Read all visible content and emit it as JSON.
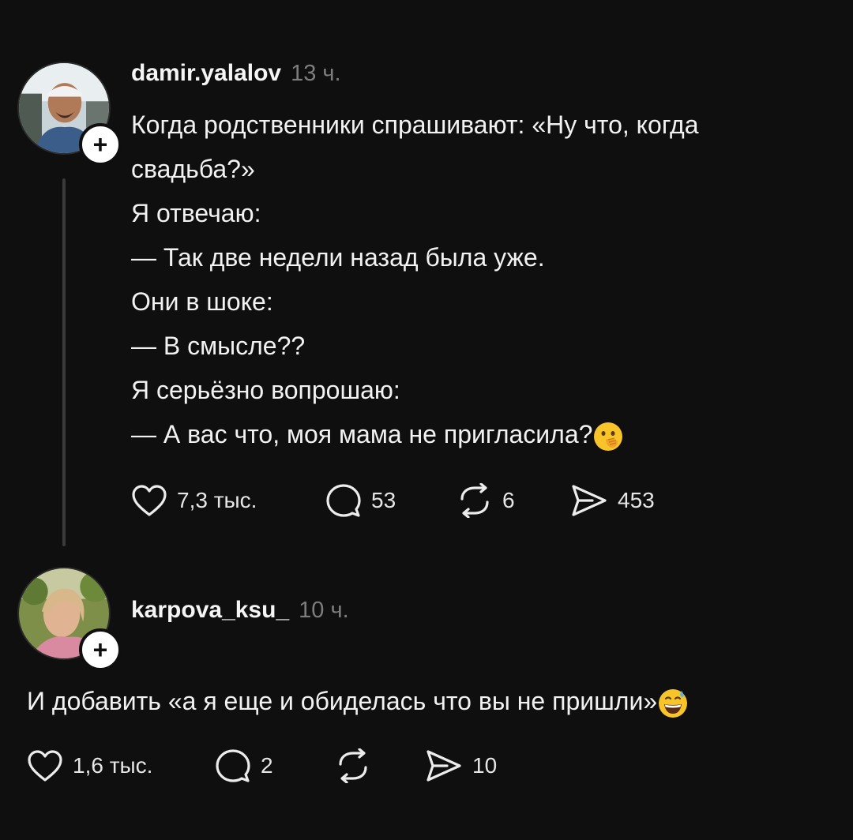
{
  "posts": [
    {
      "username": "damir.yalalov",
      "time": "13 ч.",
      "lines": [
        "Когда родственники спрашивают: «Ну что, когда",
        "свадьба?»",
        "Я отвечаю:",
        "— Так две недели назад была уже.",
        "Они в шоке:",
        "— В смысле??",
        "Я серьёзно вопрошаю:",
        "— А вас что, моя мама не пригласила?"
      ],
      "likes": "7,3 тыс.",
      "comments": "53",
      "reposts": "6",
      "shares": "453"
    },
    {
      "username": "karpova_ksu_",
      "time": "10 ч.",
      "text": "И добавить «а я еще и обиделась что вы не пришли»",
      "likes": "1,6 тыс.",
      "comments": "2",
      "reposts": "",
      "shares": "10"
    }
  ],
  "follow_symbol": "+"
}
